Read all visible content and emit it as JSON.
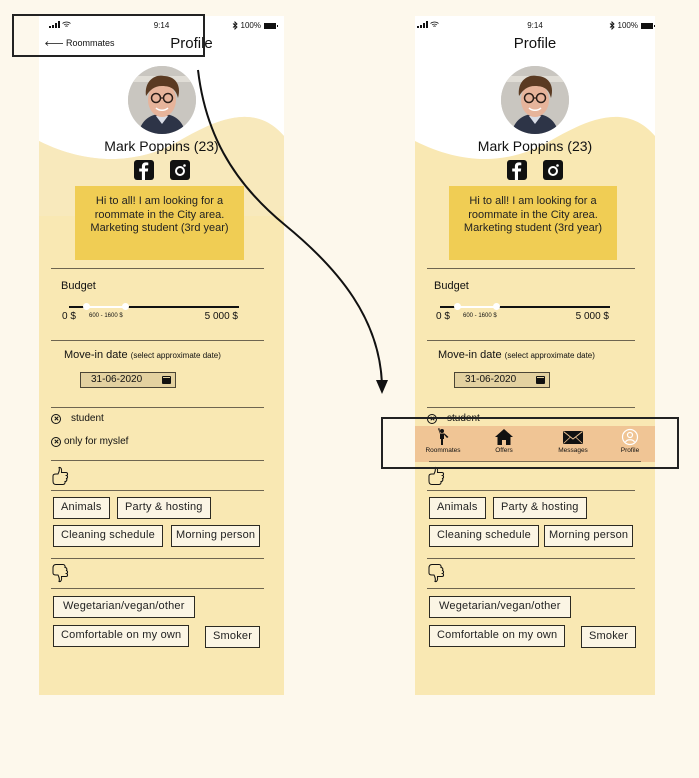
{
  "colors": {
    "page_bg": "#fdf8ec",
    "screen_bg": "#f9e8b3",
    "bio_bg": "#f0cd54",
    "nav_bg": "#f0c595",
    "tag_bg": "#fbf5e4"
  },
  "status_bar": {
    "time": "9:14",
    "battery": "100%",
    "icons": [
      "signal-icon",
      "wifi-icon",
      "bluetooth-icon",
      "battery-icon"
    ]
  },
  "screens": [
    {
      "id": "profile-before",
      "back_label": "Roommates",
      "title": "Profile"
    },
    {
      "id": "profile-after",
      "title": "Profile"
    }
  ],
  "profile": {
    "name": "Mark Poppins (23)",
    "bio": "Hi to all! I am looking for a roommate in the City area. Marketing student (3rd year)",
    "socials": [
      "facebook",
      "instagram"
    ],
    "budget": {
      "label": "Budget",
      "min_label": "0 $",
      "max_label": "5 000 $",
      "range_label": "600 - 1600 $",
      "min": 0,
      "max": 5000,
      "low": 600,
      "high": 1600
    },
    "move_in": {
      "label": "Move-in date",
      "hint": "(select approximate date)",
      "value": "31-06-2020"
    },
    "conditions": [
      "student",
      "only for myslef"
    ],
    "likes": [
      "Animals",
      "Party & hosting",
      "Cleaning schedule",
      "Morning person"
    ],
    "dislikes": [
      "Wegetarian/vegan/other",
      "Comfortable on my own",
      "Smoker"
    ]
  },
  "bottom_nav": {
    "items": [
      {
        "label": "Roommates",
        "icon": "person-waving-icon"
      },
      {
        "label": "Offers",
        "icon": "home-icon"
      },
      {
        "label": "Messages",
        "icon": "envelope-icon"
      },
      {
        "label": "Profile",
        "icon": "user-circle-icon",
        "active": true
      }
    ]
  }
}
